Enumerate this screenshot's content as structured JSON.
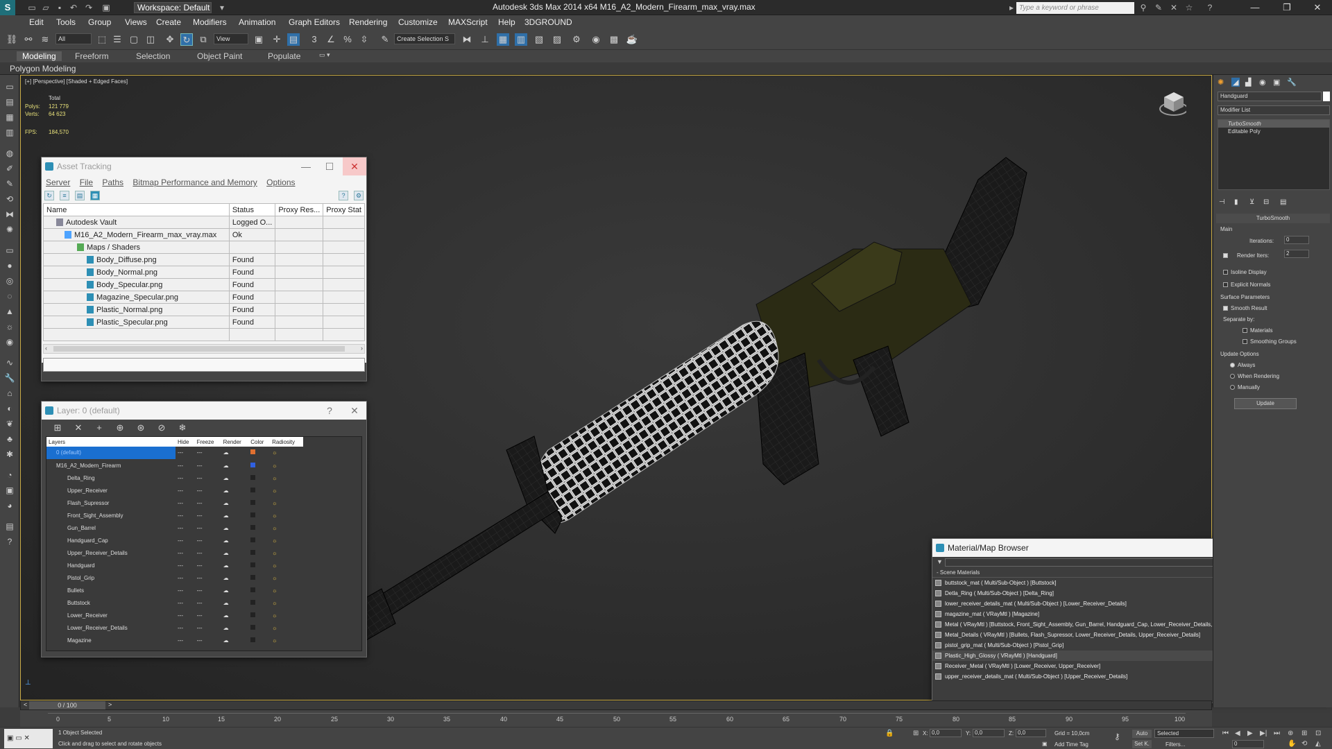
{
  "app": {
    "title": "Autodesk 3ds Max  2014 x64     M16_A2_Modern_Firearm_max_vray.max",
    "workspace": "Workspace: Default",
    "search_placeholder": "Type a keyword or phrase"
  },
  "menu": [
    "Edit",
    "Tools",
    "Group",
    "Views",
    "Create",
    "Modifiers",
    "Animation",
    "Graph Editors",
    "Rendering",
    "Customize",
    "MAXScript",
    "Help",
    "3DGROUND"
  ],
  "toolbar": {
    "filter": "All",
    "view": "View",
    "selection_set": "Create Selection S"
  },
  "ribbon": {
    "tabs": [
      "Modeling",
      "Freeform",
      "Selection",
      "Object Paint",
      "Populate"
    ],
    "panel": "Polygon Modeling"
  },
  "viewport": {
    "label": "[+] [Perspective] [Shaded + Edged Faces]",
    "stats_total": "Total",
    "polys_label": "Polys:",
    "polys": "121 779",
    "verts_label": "Verts:",
    "verts": "64 623",
    "fps_label": "FPS:",
    "fps": "184,570"
  },
  "asset_tracking": {
    "title": "Asset Tracking",
    "menu": [
      "Server",
      "File",
      "Paths",
      "Bitmap Performance and Memory",
      "Options"
    ],
    "columns": [
      "Name",
      "Status",
      "Proxy Res...",
      "Proxy Stat"
    ],
    "rows": [
      {
        "name": "Autodesk Vault",
        "status": "Logged O...",
        "indent": 1
      },
      {
        "name": "M16_A2_Modern_Firearm_max_vray.max",
        "status": "Ok",
        "indent": 2
      },
      {
        "name": "Maps / Shaders",
        "status": "",
        "indent": 3
      },
      {
        "name": "Body_Diffuse.png",
        "status": "Found",
        "indent": 4
      },
      {
        "name": "Body_Normal.png",
        "status": "Found",
        "indent": 4
      },
      {
        "name": "Body_Specular.png",
        "status": "Found",
        "indent": 4
      },
      {
        "name": "Magazine_Specular.png",
        "status": "Found",
        "indent": 4
      },
      {
        "name": "Plastic_Normal.png",
        "status": "Found",
        "indent": 4
      },
      {
        "name": "Plastic_Specular.png",
        "status": "Found",
        "indent": 4
      }
    ]
  },
  "layer": {
    "title": "Layer: 0 (default)",
    "columns": [
      "Layers",
      "Hide",
      "Freeze",
      "Render",
      "Color",
      "Radiosity"
    ],
    "rows": [
      {
        "name": "0 (default)",
        "color": "#e07030",
        "selected": true
      },
      {
        "name": "M16_A2_Modern_Firearm",
        "color": "#3060e0"
      },
      {
        "name": "Delta_Ring",
        "color": "#1a1a1a"
      },
      {
        "name": "Upper_Receiver",
        "color": "#1a1a1a"
      },
      {
        "name": "Flash_Supressor",
        "color": "#1a1a1a"
      },
      {
        "name": "Front_Sight_Assembly",
        "color": "#1a1a1a"
      },
      {
        "name": "Gun_Barrel",
        "color": "#1a1a1a"
      },
      {
        "name": "Handguard_Cap",
        "color": "#1a1a1a"
      },
      {
        "name": "Upper_Receiver_Details",
        "color": "#1a1a1a"
      },
      {
        "name": "Handguard",
        "color": "#1a1a1a"
      },
      {
        "name": "Pistol_Grip",
        "color": "#1a1a1a"
      },
      {
        "name": "Bullets",
        "color": "#1a1a1a"
      },
      {
        "name": "Buttstock",
        "color": "#1a1a1a"
      },
      {
        "name": "Lower_Receiver",
        "color": "#1a1a1a"
      },
      {
        "name": "Lower_Receiver_Details",
        "color": "#1a1a1a"
      },
      {
        "name": "Magazine",
        "color": "#1a1a1a"
      }
    ]
  },
  "material_browser": {
    "title": "Material/Map Browser",
    "section": "- Scene Materials",
    "items": [
      {
        "text": "buttstock_mat  ( Multi/Sub-Object ) [Buttstock]",
        "red": false
      },
      {
        "text": "Detla_Ring  ( Multi/Sub-Object ) [Delta_Ring]",
        "red": false
      },
      {
        "text": "lower_receiver_details_mat  ( Multi/Sub-Object ) [Lower_Receiver_Details]",
        "red": false
      },
      {
        "text": "magazine_mat  ( VRayMtl ) [Magazine]",
        "red": true
      },
      {
        "text": "Metal  ( VRayMtl ) [Buttstock, Front_Sight_Assembly, Gun_Barrel, Handguard_Cap, Lower_Receiver_Details, Upper_Receiver_Details]",
        "red": true
      },
      {
        "text": "Metal_Details  ( VRayMtl ) [Bullets, Flash_Supressor, Lower_Receiver_Details, Upper_Receiver_Details]",
        "red": true
      },
      {
        "text": "pistol_grip_mat  ( Multi/Sub-Object ) [Pistol_Grip]",
        "red": false
      },
      {
        "text": "Plastic_High_Glossy  ( VRayMtl ) [Handguard]",
        "red": true,
        "selected": true
      },
      {
        "text": "Receiver_Metal  ( VRayMtl ) [Lower_Receiver, Upper_Receiver]",
        "red": true
      },
      {
        "text": "upper_receiver_details_mat  ( Multi/Sub-Object ) [Upper_Receiver_Details]",
        "red": false
      }
    ]
  },
  "command_panel": {
    "object_name": "Handguard",
    "modifier_list": "Modifier List",
    "stack": [
      "TurboSmooth",
      "Editable Poly"
    ],
    "rollout": "TurboSmooth",
    "main": "Main",
    "iterations_label": "Iterations:",
    "iterations": "0",
    "render_iters_label": "Render Iters:",
    "render_iters": "2",
    "isoline": "Isoline Display",
    "explicit": "Explicit Normals",
    "surface": "Surface Parameters",
    "smooth": "Smooth Result",
    "separate": "Separate by:",
    "materials": "Materials",
    "smoothing": "Smoothing Groups",
    "update_options": "Update Options",
    "always": "Always",
    "when_rendering": "When Rendering",
    "manually": "Manually",
    "update": "Update"
  },
  "timeline": {
    "frame": "0 / 100",
    "ticks": [
      "0",
      "5",
      "10",
      "15",
      "20",
      "25",
      "30",
      "35",
      "40",
      "45",
      "50",
      "55",
      "60",
      "65",
      "70",
      "75",
      "80",
      "85",
      "90",
      "95",
      "100"
    ]
  },
  "status": {
    "selected": "1 Object Selected",
    "prompt": "Click and drag to select and rotate objects",
    "x_label": "X:",
    "x": "0,0",
    "y_label": "Y:",
    "y": "0,0",
    "z_label": "Z:",
    "z": "0,0",
    "grid": "Grid = 10,0cm",
    "add_time_tag": "Add Time Tag",
    "auto": "Auto",
    "set_k": "Set K.",
    "sel_mode": "Selected",
    "filters": "Filters...",
    "frame_field": "0"
  }
}
